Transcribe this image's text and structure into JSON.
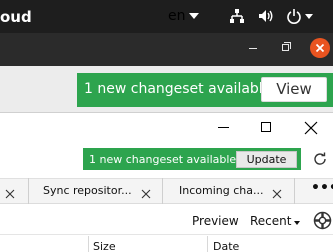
{
  "system_bar": {
    "language": "en",
    "icons": [
      "network-icon",
      "volume-icon",
      "power-icon"
    ]
  },
  "back_window": {
    "title_fragment": "oud",
    "notification": {
      "text": "1 new changeset available",
      "button_label": "View"
    }
  },
  "front_window": {
    "notification": {
      "text": "1 new changeset available",
      "button_label": "Update"
    },
    "tabs": [
      {
        "label": "Sync repositor..."
      },
      {
        "label": "Incoming cha..."
      }
    ],
    "toolbar": {
      "preview_label": "Preview",
      "recent_label": "Recent"
    },
    "columns": [
      "Size",
      "Date"
    ]
  },
  "colors": {
    "top_bar": "#1e1e1e",
    "close_button": "#e95420",
    "notification_green": "#2da44e"
  }
}
